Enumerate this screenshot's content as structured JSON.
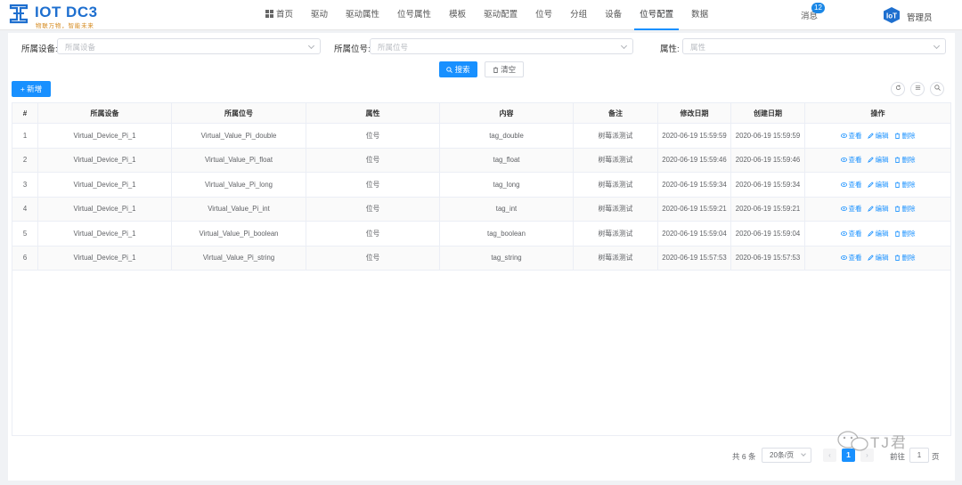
{
  "logo": {
    "title": "IOT DC3",
    "subtitle": "物联万物，智能未来"
  },
  "nav": {
    "items": [
      {
        "label": "首页",
        "icon": "grid-icon",
        "active": false
      },
      {
        "label": "驱动",
        "active": false
      },
      {
        "label": "驱动属性",
        "active": false
      },
      {
        "label": "位号属性",
        "active": false
      },
      {
        "label": "模板",
        "active": false
      },
      {
        "label": "驱动配置",
        "active": false
      },
      {
        "label": "位号",
        "active": false
      },
      {
        "label": "分组",
        "active": false
      },
      {
        "label": "设备",
        "active": false
      },
      {
        "label": "位号配置",
        "active": true
      },
      {
        "label": "数据",
        "active": false
      }
    ],
    "messages_label": "消息",
    "messages_count": "12",
    "user_label": "管理员"
  },
  "filters": {
    "device_label": "所属设备:",
    "device_placeholder": "所属设备",
    "point_label": "所属位号:",
    "point_placeholder": "所属位号",
    "attribute_label": "属性:",
    "attribute_placeholder": "属性",
    "search_label": "搜索",
    "clear_label": "清空"
  },
  "toolbar": {
    "add_label": "+ 新增",
    "refresh_icon": "refresh-icon",
    "columns_icon": "columns-icon",
    "search_icon": "search-icon"
  },
  "table": {
    "headers": [
      "#",
      "所属设备",
      "所属位号",
      "属性",
      "内容",
      "备注",
      "修改日期",
      "创建日期",
      "操作"
    ],
    "rows": [
      {
        "index": "1",
        "device": "Virtual_Device_Pi_1",
        "point": "Virtual_Value_Pi_double",
        "attribute": "位号",
        "content": "tag_double",
        "remark": "树莓派测试",
        "updated": "2020-06-19 15:59:59",
        "created": "2020-06-19 15:59:59"
      },
      {
        "index": "2",
        "device": "Virtual_Device_Pi_1",
        "point": "Virtual_Value_Pi_float",
        "attribute": "位号",
        "content": "tag_float",
        "remark": "树莓派测试",
        "updated": "2020-06-19 15:59:46",
        "created": "2020-06-19 15:59:46"
      },
      {
        "index": "3",
        "device": "Virtual_Device_Pi_1",
        "point": "Virtual_Value_Pi_long",
        "attribute": "位号",
        "content": "tag_long",
        "remark": "树莓派测试",
        "updated": "2020-06-19 15:59:34",
        "created": "2020-06-19 15:59:34"
      },
      {
        "index": "4",
        "device": "Virtual_Device_Pi_1",
        "point": "Virtual_Value_Pi_int",
        "attribute": "位号",
        "content": "tag_int",
        "remark": "树莓派测试",
        "updated": "2020-06-19 15:59:21",
        "created": "2020-06-19 15:59:21"
      },
      {
        "index": "5",
        "device": "Virtual_Device_Pi_1",
        "point": "Virtual_Value_Pi_boolean",
        "attribute": "位号",
        "content": "tag_boolean",
        "remark": "树莓派测试",
        "updated": "2020-06-19 15:59:04",
        "created": "2020-06-19 15:59:04"
      },
      {
        "index": "6",
        "device": "Virtual_Device_Pi_1",
        "point": "Virtual_Value_Pi_string",
        "attribute": "位号",
        "content": "tag_string",
        "remark": "树莓派测试",
        "updated": "2020-06-19 15:57:53",
        "created": "2020-06-19 15:57:53"
      }
    ],
    "actions": {
      "view": "查看",
      "edit": "编辑",
      "delete": "删除"
    }
  },
  "pagination": {
    "total_text": "共 6 条",
    "page_size": "20条/页",
    "current_page": "1",
    "goto_label": "前往",
    "goto_value": "1",
    "page_suffix": "页"
  },
  "watermark": {
    "text": "TJ君"
  },
  "colors": {
    "primary": "#1890ff",
    "logo_blue": "#1e6fcf",
    "logo_orange": "#d58a1f"
  }
}
